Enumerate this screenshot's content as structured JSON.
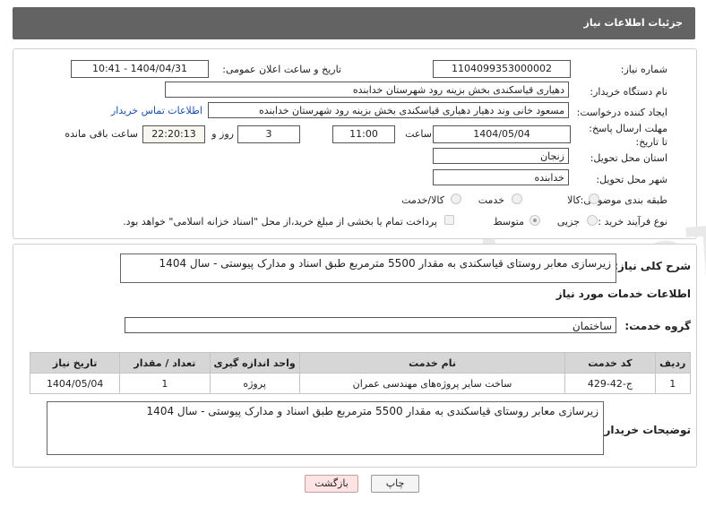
{
  "header": {
    "title": "جزئیات اطلاعات نیاز"
  },
  "form": {
    "need_number_label": "شماره نیاز:",
    "need_number": "1104099353000002",
    "announce_label": "تاریخ و ساعت اعلان عمومی:",
    "announce_value": "1404/04/31 - 10:41",
    "buyer_org_label": "نام دستگاه خریدار:",
    "buyer_org": "دهیاری قیاسکندی بخش بزینه رود شهرستان خدابنده",
    "creator_label": "ایجاد کننده درخواست:",
    "creator": "مسعود خانی وند دهیار دهیاری قیاسکندی بخش بزینه رود شهرستان خدابنده",
    "contact_link": "اطلاعات تماس خریدار",
    "deadline_label": "مهلت ارسال پاسخ: تا تاریخ:",
    "deadline_date": "1404/05/04",
    "time_label": "ساعت",
    "deadline_time": "11:00",
    "days_value": "3",
    "days_label": "روز و",
    "remaining_time": "22:20:13",
    "remaining_label": "ساعت باقی مانده",
    "province_label": "استان محل تحویل:",
    "province": "زنجان",
    "city_label": "شهر محل تحویل:",
    "city": "خدابنده",
    "category_label": "طبقه بندی موضوعی:",
    "category_options": [
      "کالا",
      "خدمت",
      "کالا/خدمت"
    ],
    "process_label": "نوع فرآیند خرید :",
    "process_options": [
      "جزیی",
      "متوسط"
    ],
    "payment_note": "پرداخت تمام یا بخشی از مبلغ خرید،از محل \"اسناد خزانه اسلامی\" خواهد بود."
  },
  "detail": {
    "summary_label": "شرح کلی نیاز:",
    "summary": "زیرسازی معابر روستای قیاسکندی به مقدار 5500 مترمربع طبق اسناد و مدارک پیوستی - سال 1404",
    "services_title": "اطلاعات خدمات مورد نیاز",
    "service_group_label": "گروه خدمت:",
    "service_group": "ساختمان",
    "table": {
      "headers": [
        "ردیف",
        "کد خدمت",
        "نام خدمت",
        "واحد اندازه گیری",
        "تعداد / مقدار",
        "تاریخ نیاز"
      ],
      "rows": [
        [
          "1",
          "ج-42-429",
          "ساخت سایر پروژه‌های مهندسی عمران",
          "پروژه",
          "1",
          "1404/05/04"
        ]
      ]
    },
    "buyer_notes_label": "توضیحات خریدار:",
    "buyer_notes": "زیرسازی معابر روستای قیاسکندی به مقدار 5500 مترمربع طبق اسناد و مدارک پیوستی - سال 1404"
  },
  "buttons": {
    "print": "چاپ",
    "back": "بازگشت"
  },
  "watermark": "AriaTender.neT"
}
